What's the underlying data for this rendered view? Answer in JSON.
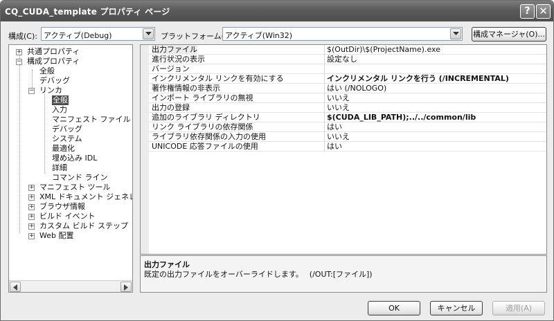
{
  "window": {
    "title": "CQ_CUDA_template プロパティ ページ",
    "help_glyph": "?",
    "close_glyph": "✕"
  },
  "toolbar": {
    "config_label": "構成(C):",
    "config_value": "アクティブ(Debug)",
    "platform_label": "プラットフォーム(P):",
    "platform_value": "アクティブ(Win32)",
    "config_manager_label": "構成マネージャ(O)..."
  },
  "tree": {
    "common": "共通プロパティ",
    "config": "構成プロパティ",
    "general": "全般",
    "debug": "デバッグ",
    "linker": "リンカ",
    "linker_items": [
      "全般",
      "入力",
      "マニフェスト ファイル",
      "デバッグ",
      "システム",
      "最適化",
      "埋め込み IDL",
      "詳細",
      "コマンド ライン"
    ],
    "other_items": [
      "マニフェスト ツール",
      "XML ドキュメント ジェネレータ",
      "ブラウザ情報",
      "ビルド イベント",
      "カスタム ビルド ステップ",
      "Web 配置"
    ],
    "expand_plus": "+",
    "expand_minus": "−"
  },
  "properties": [
    {
      "name": "出力ファイル",
      "value": "$(OutDir)\\$(ProjectName).exe",
      "bold": false
    },
    {
      "name": "進行状況の表示",
      "value": "設定なし",
      "bold": false
    },
    {
      "name": "バージョン",
      "value": "",
      "bold": false
    },
    {
      "name": "インクリメンタル リンクを有効にする",
      "value": "インクリメンタル リンクを行う (/INCREMENTAL)",
      "bold": true
    },
    {
      "name": "著作権情報の非表示",
      "value": "はい (/NOLOGO)",
      "bold": false
    },
    {
      "name": "インポート ライブラリの無視",
      "value": "いいえ",
      "bold": false
    },
    {
      "name": "出力の登録",
      "value": "いいえ",
      "bold": false
    },
    {
      "name": "追加のライブラリ ディレクトリ",
      "value": "$(CUDA_LIB_PATH);../../common/lib",
      "bold": true
    },
    {
      "name": "リンク ライブラリの依存関係",
      "value": "はい",
      "bold": false
    },
    {
      "name": "ライブラリ依存関係の入力の使用",
      "value": "いいえ",
      "bold": false
    },
    {
      "name": "UNICODE 応答ファイルの使用",
      "value": "はい",
      "bold": false
    }
  ],
  "description": {
    "title": "出力ファイル",
    "body": "既定の出力ファイルをオーバーライドします。　 (/OUT:[ファイル])"
  },
  "buttons": {
    "ok": "OK",
    "cancel": "キャンセル",
    "apply": "適用(A)"
  }
}
